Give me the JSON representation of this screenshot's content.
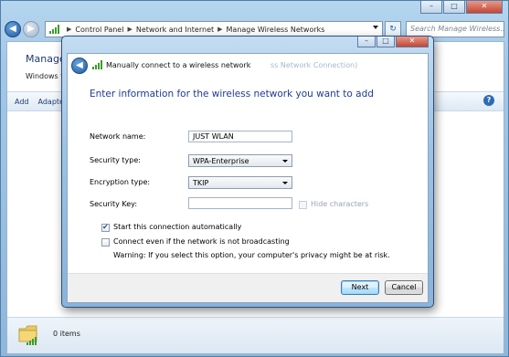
{
  "explorer": {
    "address": [
      "Control Panel",
      "Network and Internet",
      "Manage Wireless Networks"
    ],
    "search_placeholder": "Search Manage Wireless...",
    "heading": "Manage",
    "description": "Windows tr",
    "toolbar": [
      "Add",
      "Adapte"
    ],
    "status_count": "0 items"
  },
  "dialog": {
    "title": "Manually connect to a wireless network",
    "title_ghost": "ss Network Connection)",
    "heading": "Enter information for the wireless network you want to add",
    "network_name_label": "Network name:",
    "network_name_value": "JUST WLAN",
    "security_type_label": "Security type:",
    "security_type_value": "WPA-Enterprise",
    "encryption_type_label": "Encryption type:",
    "encryption_type_value": "TKIP",
    "security_key_label": "Security Key:",
    "security_key_value": "",
    "hide_characters_label": "Hide characters",
    "start_auto_label": "Start this connection automatically",
    "start_auto_checked": true,
    "connect_hidden_label": "Connect even if the network is not broadcasting",
    "connect_hidden_checked": false,
    "warning": "Warning: If you select this option, your computer's privacy might be at risk.",
    "next_label": "Next",
    "cancel_label": "Cancel"
  },
  "colors": {
    "accent": "#1e3a96",
    "frame": "#9dc3e6"
  }
}
